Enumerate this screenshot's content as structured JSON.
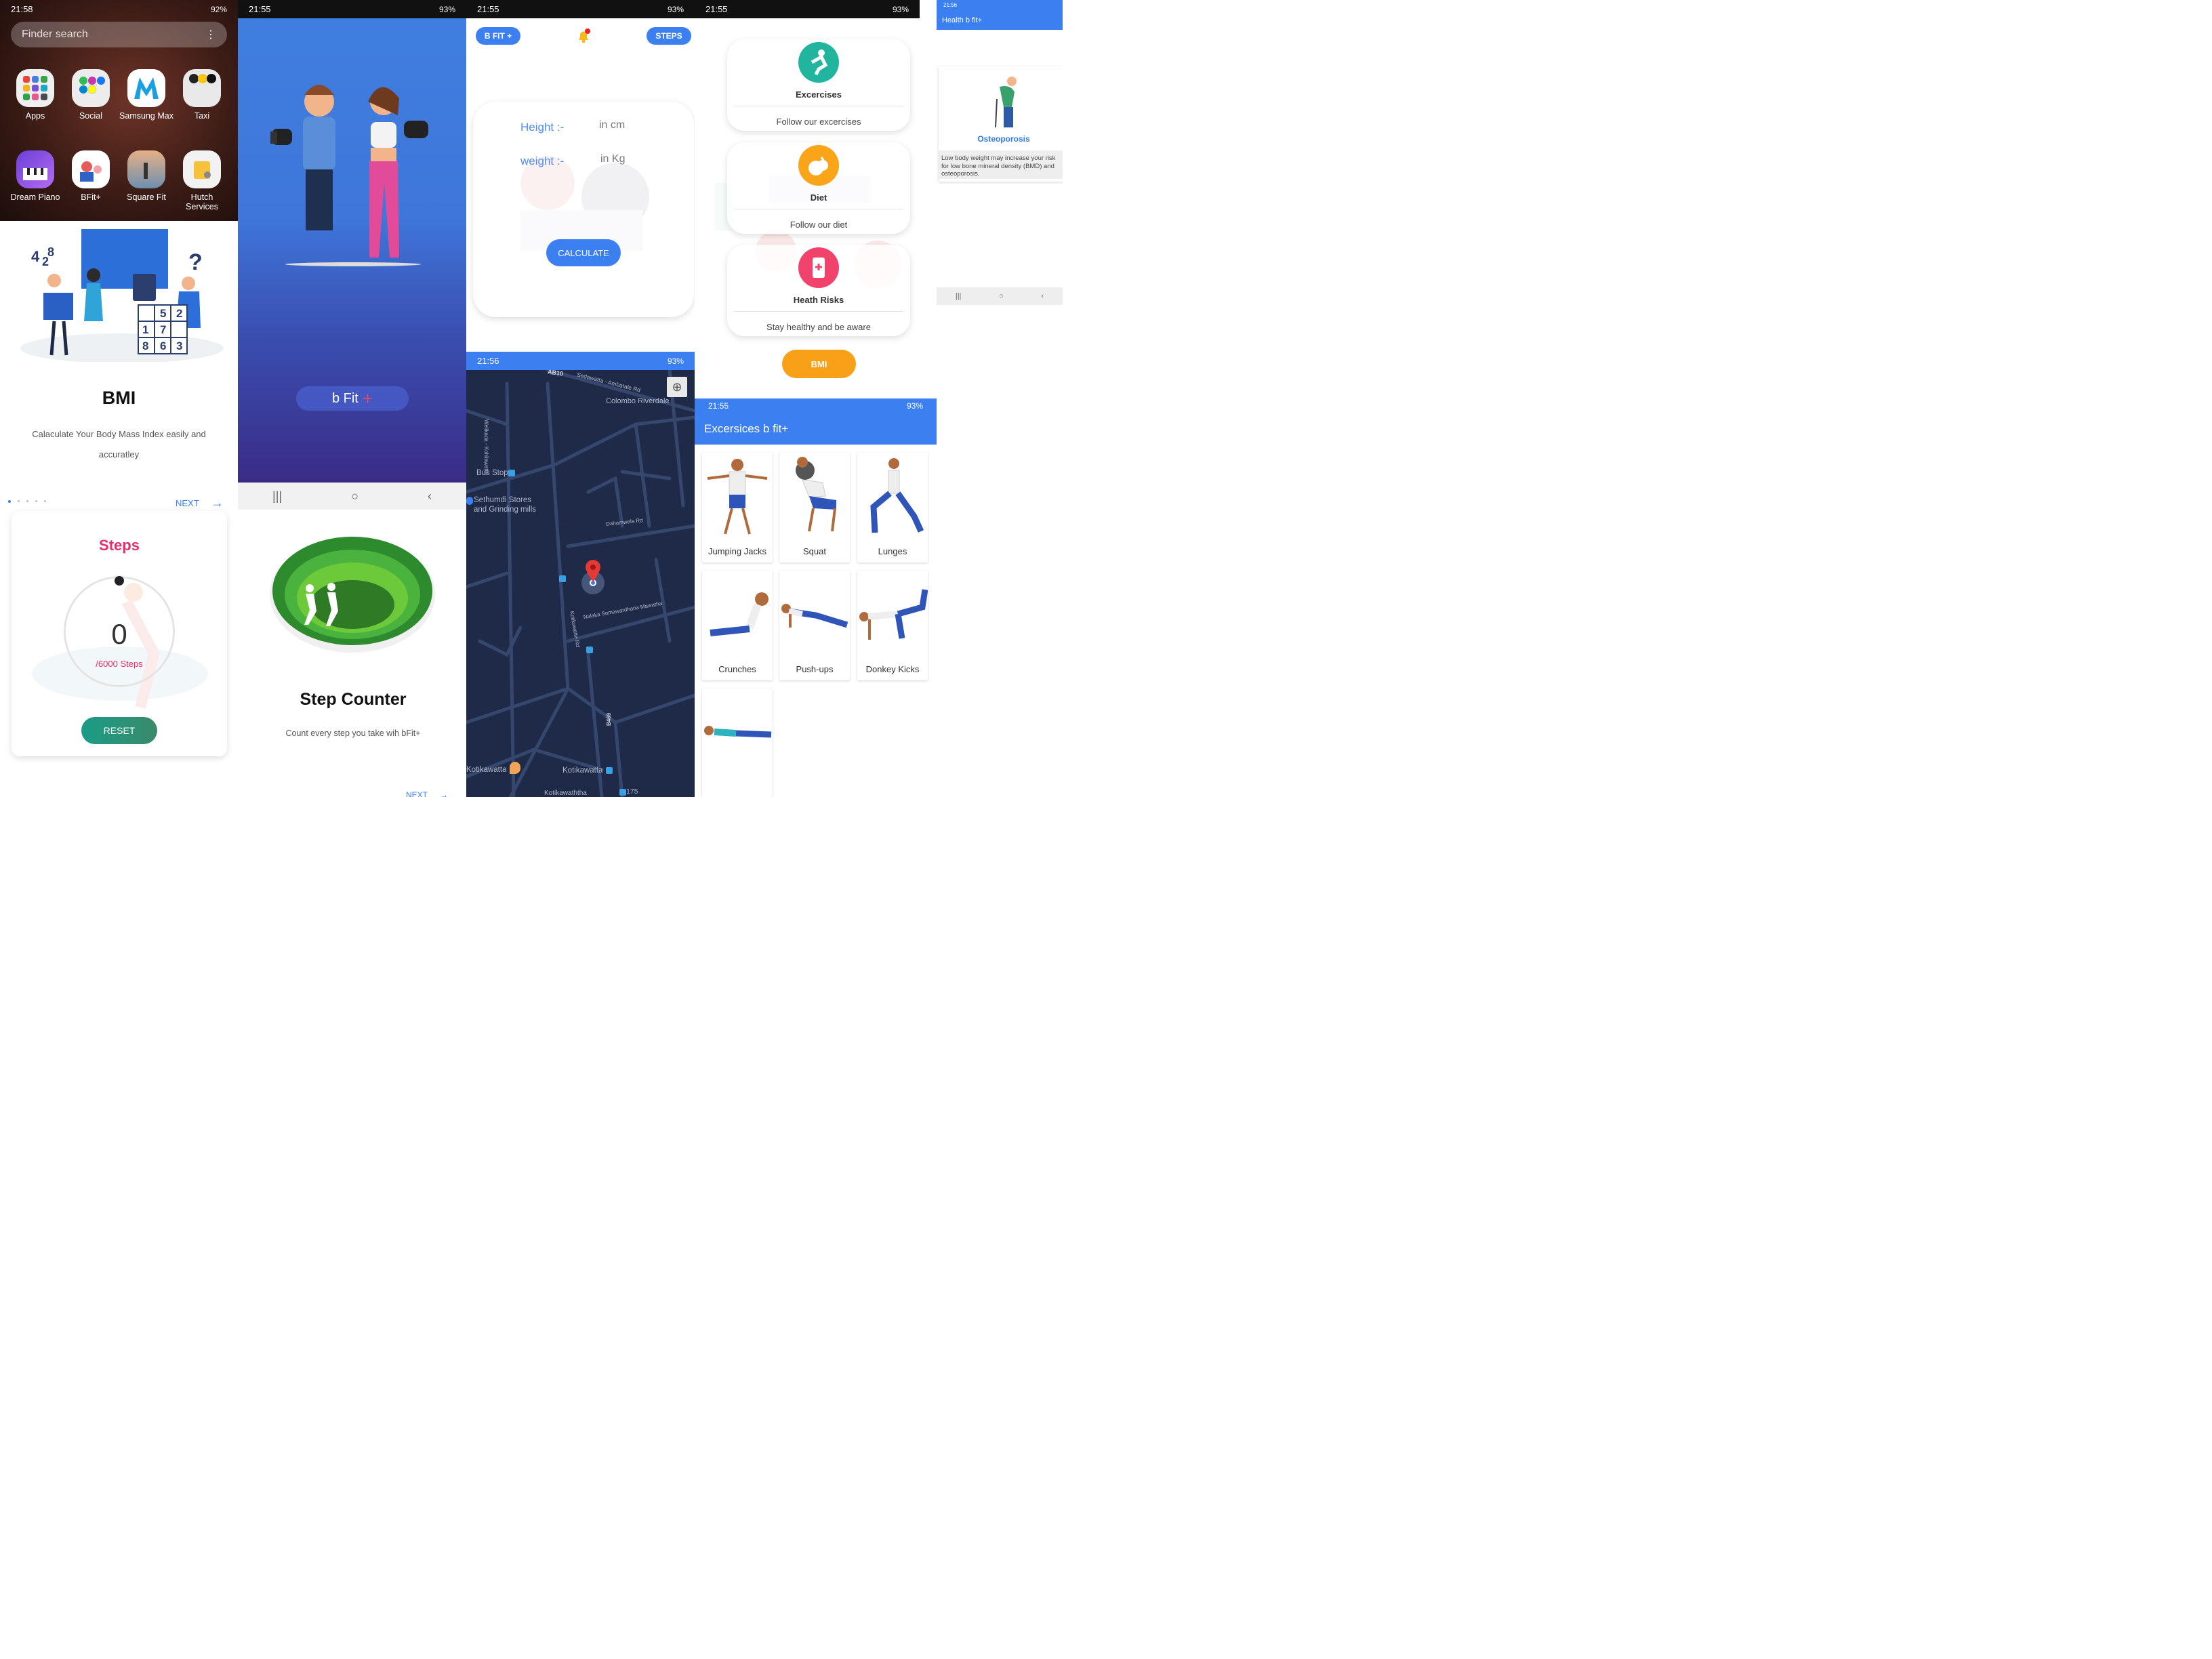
{
  "home": {
    "time": "21:58",
    "status": "19 92%",
    "battery": "92%",
    "search_placeholder": "Finder search",
    "apps": [
      {
        "label": "Apps"
      },
      {
        "label": "Social"
      },
      {
        "label": "Samsung Max"
      },
      {
        "label": "Taxi"
      },
      {
        "label": "Dream Piano"
      },
      {
        "label": "BFit+"
      },
      {
        "label": "Square Fit"
      },
      {
        "label": "Hutch Services"
      }
    ]
  },
  "splash": {
    "time": "21:55",
    "battery": "93%",
    "brand": "b Fit",
    "plus": "+"
  },
  "calc": {
    "time": "21:55",
    "battery": "93%",
    "bfit_btn": "B FIT +",
    "steps_btn": "STEPS",
    "height_label": "Height :-",
    "height_unit": "in cm",
    "weight_label": "weight :-",
    "weight_unit": "in Kg",
    "calculate": "CALCULATE"
  },
  "menu": {
    "time": "21:55",
    "battery": "93%",
    "items": [
      {
        "title": "Excercises",
        "desc": "Follow our excercises"
      },
      {
        "title": "Diet",
        "desc": "Follow our diet"
      },
      {
        "title": "Heath Risks",
        "desc": "Stay healthy and be aware"
      }
    ],
    "bmi_btn": "BMI"
  },
  "risk": {
    "time": "21:56",
    "header": "Health b fit+",
    "title": "Osteoporosis",
    "desc": "Low body weight may increase your risk for low bone mineral density (BMD) and osteoporosis."
  },
  "onboard_bmi": {
    "title": "BMI",
    "desc1": "Calaculate Your Body Mass Index easily and",
    "desc2": "accuratley",
    "next": "NEXT",
    "digits": [
      "4",
      "2",
      "8",
      "?",
      "5",
      "2",
      "1",
      "7",
      "8",
      "6",
      "3"
    ]
  },
  "map": {
    "time": "21:56",
    "battery": "93%",
    "labels": {
      "ab10": "AB10",
      "sedawatta": "Sedawatta - Ambatale Rd",
      "colombo": "Colombo Riverdale",
      "busstop": "Bus Stop",
      "sethumdi1": "Sethumdi Stores",
      "sethumdi2": "and Grinding mills",
      "dahamwela": "Dahamwela Rd",
      "naalaka": "Nalaka Somawardhana Mawatha",
      "kotikawatte_rd": "Kotikawatte Rd",
      "welikada": "Welikada - Kohilawatta",
      "b469": "B469",
      "kotikawatta1": "Kotikawatta",
      "kotikawatta2": "Kotikawatta",
      "kotikawaththa": "Kotikawaththa",
      "num175": "175"
    }
  },
  "exercises": {
    "time": "21:55",
    "battery": "93%",
    "header": "Excersices b fit+",
    "items": [
      "Jumping Jacks",
      "Squat",
      "Lunges",
      "Crunches",
      "Push-ups",
      "Donkey Kicks",
      ""
    ]
  },
  "steps": {
    "title": "Steps",
    "count": "0",
    "goal": "/6000 Steps",
    "reset": "RESET"
  },
  "stepcounter": {
    "title": "Step Counter",
    "desc": "Count every step you take wih bFit+",
    "next": "NEXT"
  },
  "colors": {
    "blue": "#3b7ff1",
    "pink": "#e62e6b",
    "orange": "#f9a019",
    "teal": "#21a898",
    "navy": "#1f2a48"
  }
}
